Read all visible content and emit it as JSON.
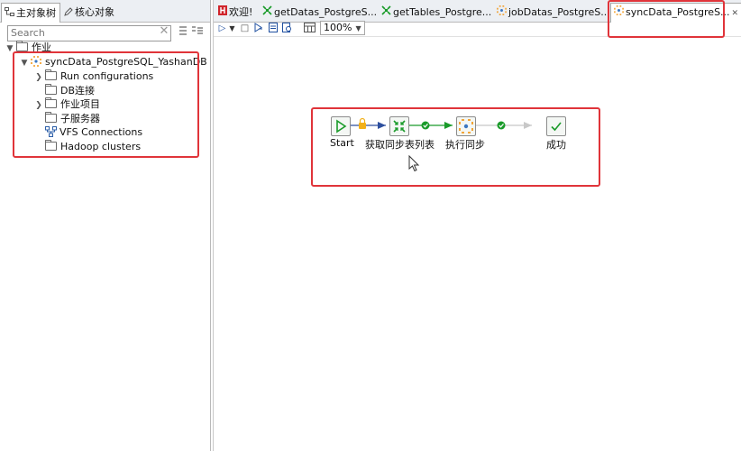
{
  "left_tabs": {
    "main_objects": "主对象树",
    "core_objects": "核心对象"
  },
  "search": {
    "placeholder": "Search"
  },
  "tree": {
    "root": "作业",
    "job": "syncData_PostgreSQL_YashanDB",
    "children": [
      "Run configurations",
      "DB连接",
      "作业项目",
      "子服务器",
      "VFS Connections",
      "Hadoop clusters"
    ]
  },
  "editor_tabs": [
    "欢迎!",
    "getDatas_PostgreS...",
    "getTables_Postgre...",
    "jobDatas_PostgreS...",
    "syncData_PostgreS..."
  ],
  "toolbar": {
    "zoom": "100%"
  },
  "flow": {
    "steps": [
      "Start",
      "获取同步表列表",
      "执行同步",
      "成功"
    ]
  },
  "colors": {
    "highlight_box": "#e0343a",
    "hop_success": "#1a9b2a",
    "hop_unconditional": "#2d4f9e",
    "hop_disabled": "#c8c8c8"
  }
}
